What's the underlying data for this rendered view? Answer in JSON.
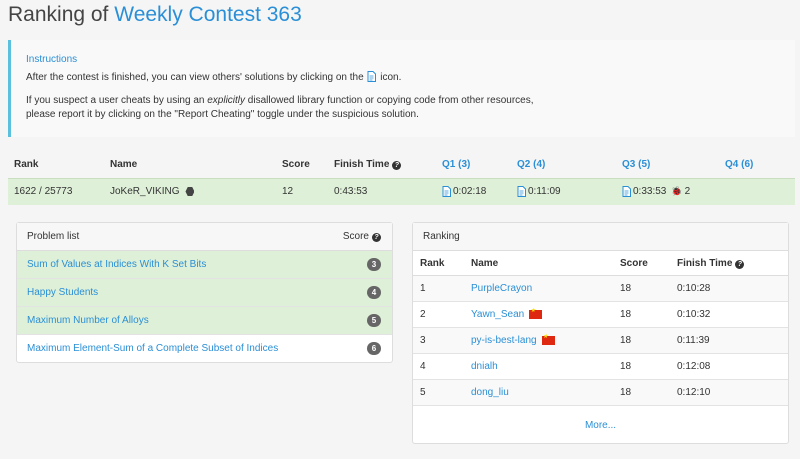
{
  "page": {
    "title_prefix": "Ranking of",
    "title_contest": "Weekly Contest 363"
  },
  "instructions": {
    "heading": "Instructions",
    "line1_before": "After the contest is finished, you can view others' solutions by clicking on the",
    "line1_after": "icon.",
    "line2_before": "If you suspect a user cheats by using an",
    "line2_em": "explicitly",
    "line2_after": "disallowed library function or copying code from other resources,",
    "line3": "please report it by clicking on the \"Report Cheating\" toggle under the suspicious solution."
  },
  "ranking_table": {
    "headers": {
      "rank": "Rank",
      "name": "Name",
      "score": "Score",
      "finish_time": "Finish Time",
      "q1": "Q1 (3)",
      "q2": "Q2 (4)",
      "q3": "Q3 (5)",
      "q4": "Q4 (6)"
    },
    "row": {
      "rank": "1622 / 25773",
      "name": "JoKeR_VIKING",
      "score": "12",
      "finish_time": "0:43:53",
      "q1": "0:02:18",
      "q2": "0:11:09",
      "q3": "0:33:53",
      "q3_wrong": "2"
    }
  },
  "problem_list": {
    "title": "Problem list",
    "score_label": "Score",
    "items": [
      {
        "name": "Sum of Values at Indices With K Set Bits",
        "score": "3"
      },
      {
        "name": "Happy Students",
        "score": "4"
      },
      {
        "name": "Maximum Number of Alloys",
        "score": "5"
      },
      {
        "name": "Maximum Element-Sum of a Complete Subset of Indices",
        "score": "6"
      }
    ]
  },
  "leaderboard": {
    "title": "Ranking",
    "headers": {
      "rank": "Rank",
      "name": "Name",
      "score": "Score",
      "finish_time": "Finish Time"
    },
    "rows": [
      {
        "rank": "1",
        "name": "PurpleCrayon",
        "score": "18",
        "time": "0:10:28"
      },
      {
        "rank": "2",
        "name": "Yawn_Sean",
        "score": "18",
        "time": "0:10:32"
      },
      {
        "rank": "3",
        "name": "py-is-best-lang",
        "score": "18",
        "time": "0:11:39"
      },
      {
        "rank": "4",
        "name": "dnialh",
        "score": "18",
        "time": "0:12:08"
      },
      {
        "rank": "5",
        "name": "dong_liu",
        "score": "18",
        "time": "0:12:10"
      }
    ],
    "more_link": "More..."
  },
  "colors": {
    "accent": "#2a8fd6",
    "solved_bg": "#dff0d8",
    "instructions_border": "#5bc0de"
  }
}
